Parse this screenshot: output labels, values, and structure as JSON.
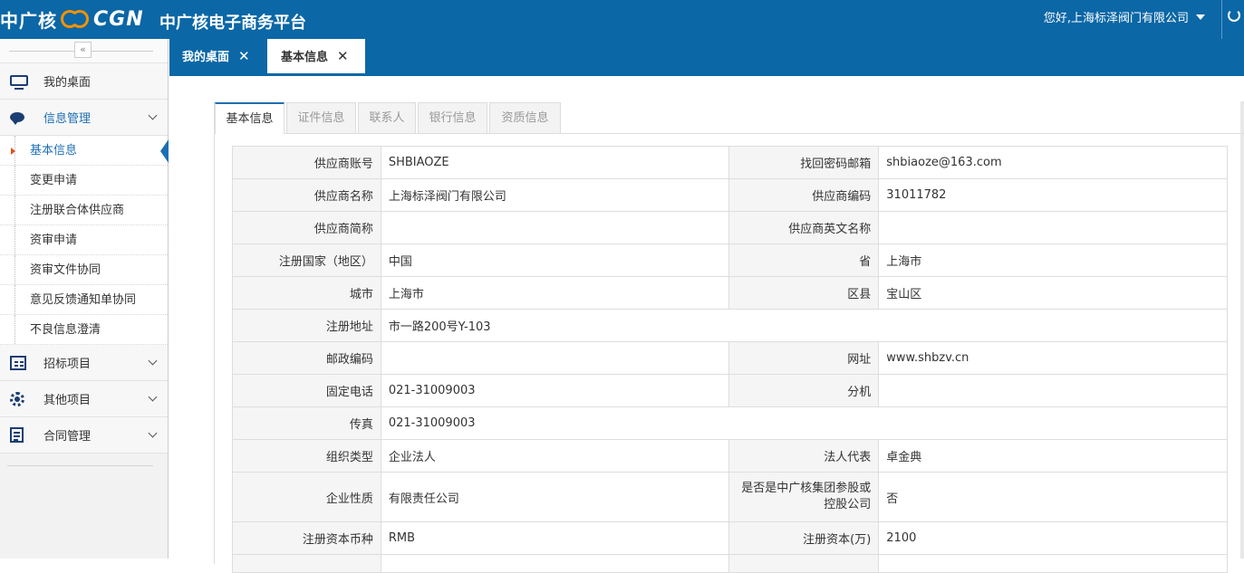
{
  "header": {
    "logo_cn": "中广核",
    "logo_en": "CGN",
    "platform_title": "中广核电子商务平台",
    "user_greeting": "您好,上海标泽阀门有限公司"
  },
  "sidebar": {
    "collapse_label": "«",
    "items": [
      {
        "label": "我的桌面",
        "icon": "monitor-icon"
      },
      {
        "label": "信息管理",
        "icon": "chat-icon"
      },
      {
        "label": "招标项目",
        "icon": "tender-grid-icon"
      },
      {
        "label": "其他项目",
        "icon": "gear-icon"
      },
      {
        "label": "合同管理",
        "icon": "contract-icon"
      }
    ],
    "sub_items": [
      {
        "label": "基本信息"
      },
      {
        "label": "变更申请"
      },
      {
        "label": "注册联合体供应商"
      },
      {
        "label": "资审申请"
      },
      {
        "label": "资审文件协同"
      },
      {
        "label": "意见反馈通知单协同"
      },
      {
        "label": "不良信息澄清"
      }
    ]
  },
  "tabs": [
    {
      "label": "我的桌面",
      "close": "✕"
    },
    {
      "label": "基本信息",
      "close": "✕"
    }
  ],
  "inner_tabs": [
    "基本信息",
    "证件信息",
    "联系人",
    "银行信息",
    "资质信息"
  ],
  "info": {
    "rows": [
      {
        "l1": "供应商账号",
        "v1": "SHBIAOZE",
        "l2": "找回密码邮箱",
        "v2": "shbiaoze@163.com"
      },
      {
        "l1": "供应商名称",
        "v1": "上海标泽阀门有限公司",
        "l2": "供应商编码",
        "v2": "31011782"
      },
      {
        "l1": "供应商简称",
        "v1": "",
        "l2": "供应商英文名称",
        "v2": ""
      },
      {
        "l1": "注册国家（地区）",
        "v1": "中国",
        "l2": "省",
        "v2": "上海市"
      },
      {
        "l1": "城市",
        "v1": "上海市",
        "l2": "区县",
        "v2": "宝山区"
      },
      {
        "l1": "注册地址",
        "v1": "市一路200号Y-103"
      },
      {
        "l1": "邮政编码",
        "v1": "",
        "l2": "网址",
        "v2": "www.shbzv.cn"
      },
      {
        "l1": "固定电话",
        "v1": "021-31009003",
        "l2": "分机",
        "v2": ""
      },
      {
        "l1": "传真",
        "v1": "021-31009003"
      },
      {
        "l1": "组织类型",
        "v1": "企业法人",
        "l2": "法人代表",
        "v2": "卓金典"
      },
      {
        "l1": "企业性质",
        "v1": "有限责任公司",
        "l2": "是否是中广核集团参股或控股公司",
        "v2": "否"
      },
      {
        "l1": "注册资本币种",
        "v1": "RMB",
        "l2": "注册资本(万)",
        "v2": "2100"
      }
    ]
  },
  "colors": {
    "primary": "#0b67a6",
    "accent": "#1d6fb3",
    "logo_orange": "#f39200"
  }
}
